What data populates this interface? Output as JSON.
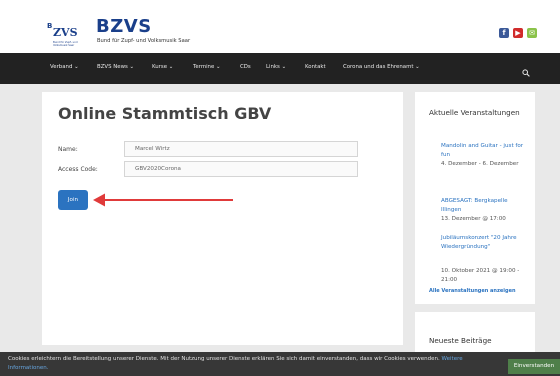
{
  "header": {
    "logo_letter": "B",
    "logo_text": "ZVS",
    "logo_tagline": "Bund für Zupf- und Volksmusik Saar",
    "site_title": "BZVS",
    "site_subtitle": "Bund für Zupf- und Volksmusik Saar",
    "social": {
      "facebook": "f",
      "youtube": "▶",
      "email": "✉"
    }
  },
  "nav": {
    "items": [
      {
        "label": "Verband",
        "chevron": true
      },
      {
        "label": "BZVS News",
        "chevron": true
      },
      {
        "label": "Kurse",
        "chevron": true
      },
      {
        "label": "Termine",
        "chevron": true
      },
      {
        "label": "CDs",
        "chevron": false
      },
      {
        "label": "Links",
        "chevron": true
      },
      {
        "label": "Kontakt",
        "chevron": false
      },
      {
        "label": "Corona und das Ehrenamt",
        "chevron": true
      }
    ],
    "search_icon": "search-icon"
  },
  "main": {
    "title": "Online Stammtisch GBV",
    "name_label": "Name:",
    "name_value": "Marcel Wirtz",
    "code_label": "Access Code:",
    "code_value": "GBV2020Corona",
    "join_label": "Join",
    "arrow_color": "#e03a3a"
  },
  "sidebar": {
    "events_heading": "Aktuelle Veranstaltungen",
    "events": [
      {
        "title": "Mandolin and Guitar - just for fun",
        "date": "4. Dezember - 6. Dezember"
      },
      {
        "title": "ABGESAGT: Bergkapelle Illingen",
        "date": "13. Dezember @ 17:00"
      },
      {
        "title": "Jubiläumskonzert \"20 Jahre Wiedergründung\"",
        "date": "10. Oktober 2021 @ 19:00 - 21:00"
      }
    ],
    "all_events": "Alle Veranstaltungen anzeigen",
    "posts_heading": "Neueste Beiträge"
  },
  "cookie": {
    "text": "Cookies erleichtern die Bereitstellung unserer Dienste. Mit der Nutzung unserer Dienste erklären Sie sich damit einverstanden, dass wir Cookies verwenden.",
    "more": "Weitere Informationen.",
    "accept": "Einverstanden"
  },
  "colors": {
    "brand_blue": "#1a3f8a",
    "link_blue": "#2b73c0",
    "nav_bg": "#222222",
    "cookie_bg": "#373737",
    "accept_green": "#4f7f4a"
  }
}
